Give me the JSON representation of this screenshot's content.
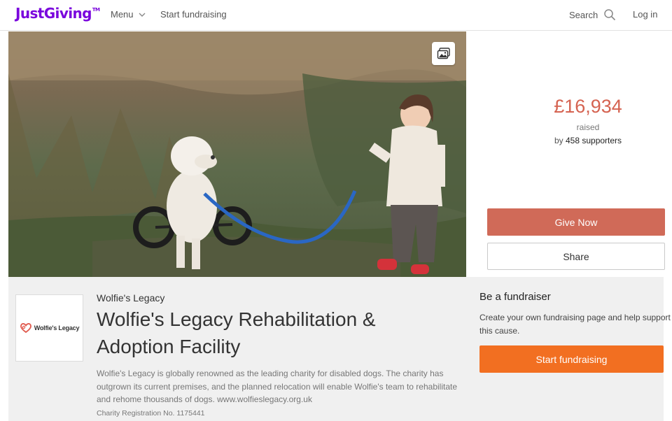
{
  "nav": {
    "logo": "JustGiving",
    "logo_tm": "TM",
    "menu": "Menu",
    "start": "Start fundraising",
    "search": "Search",
    "login": "Log in"
  },
  "raised": {
    "amount": "£16,934",
    "word": "raised",
    "by_prefix": "by",
    "supporters_count": "458",
    "supporters_word": "supporters"
  },
  "actions": {
    "give": "Give Now",
    "share": "Share"
  },
  "charity": {
    "logo_text": "Wolfie's Legacy",
    "name": "Wolfie's Legacy",
    "title": "Wolfie's Legacy Rehabilitation & Adoption Facility",
    "description": "Wolfie's Legacy is globally renowned as the leading charity for disabled dogs. The charity has outgrown its current premises, and the planned relocation will enable Wolfie's team to rehabilitate and rehome thousands of dogs. www.wolfieslegacy.org.uk",
    "registration": "Charity Registration No. 1175441"
  },
  "fundraiser": {
    "title": "Be a fundraiser",
    "text": "Create your own fundraising page and help support this cause.",
    "button": "Start fundraising"
  },
  "colors": {
    "brand": "#7a04dd",
    "raised": "#d56351",
    "give": "#d06a58",
    "start": "#f26f21"
  },
  "icons": {
    "search": "search-icon",
    "menu_chevron": "chevron-down-icon",
    "gallery": "image-gallery-icon",
    "charity_logo": "heart-logo-icon"
  }
}
